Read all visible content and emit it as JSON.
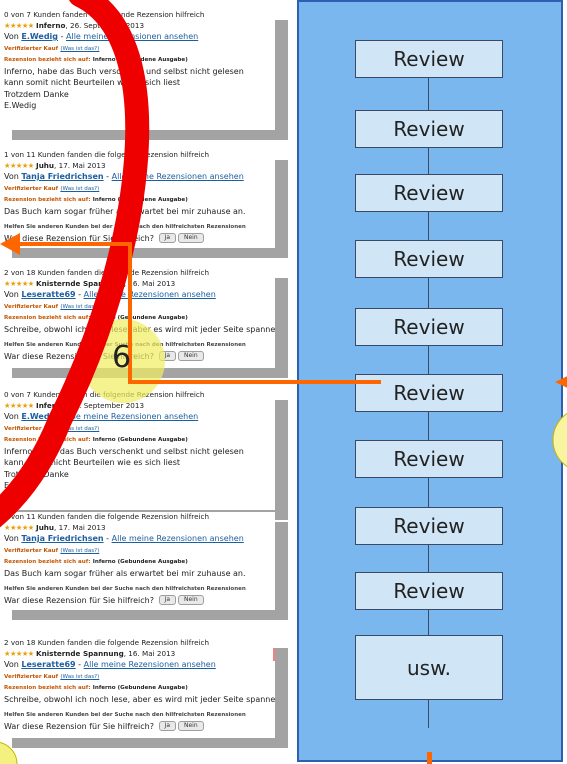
{
  "reviews": [
    {
      "helpful": "0 von 7 Kunden fanden die folgende Rezension hilfreich",
      "stars": "★★★★★",
      "title": "Inferno",
      "date": ", 26. September 2013",
      "by": "Von ",
      "author": "E.Wedig",
      "all_link": "Alle meine Rezensionen ansehen",
      "verified": "Verifizierter Kauf",
      "what": "(Was ist das?)",
      "refers_label": "Rezension bezieht sich auf:",
      "refers_value": "Inferno (Gebundene Ausgabe)",
      "body": [
        "Inferno, habe das Buch verschenkt und selbst nicht gelesen",
        "kann somit nicht Beurteilen wie es sich liest",
        "Trotzdem Danke",
        "E.Wedig"
      ],
      "help": "",
      "question": "",
      "yes": "",
      "no": ""
    },
    {
      "helpful": "1 von 11 Kunden fanden die folgende Rezension hilfreich",
      "stars": "★★★★★",
      "title": "Juhu",
      "date": ", 17. Mai 2013",
      "by": "Von ",
      "author": "Tanja Friedrichsen",
      "all_link": "Alle meine Rezensionen ansehen",
      "verified": "Verifizierter Kauf",
      "what": "(Was ist das?)",
      "refers_label": "Rezension bezieht sich auf:",
      "refers_value": "Inferno (Gebundene Ausgabe)",
      "body": [
        "Das Buch kam sogar früher als erwartet bei mir zuhause an."
      ],
      "help": "Helfen Sie anderen Kunden bei der Suche nach den hilfreichsten Rezensionen",
      "question": "War diese Rezension für Sie hilfreich?",
      "yes": "Ja",
      "no": "Nein"
    },
    {
      "helpful": "2 von 18 Kunden fanden die folgende Rezension hilfreich",
      "stars": "★★★★★",
      "title": "Knisternde Spannung",
      "date": ", 16. Mai 2013",
      "by": "Von ",
      "author": "Leseratte69",
      "all_link": "Alle meine Rezensionen ansehen",
      "verified": "Verifizierter Kauf",
      "what": "(Was ist das?)",
      "refers_label": "Rezension bezieht sich auf:",
      "refers_value": "Inferno (Gebundene Ausgabe)",
      "body": [
        "Schreibe, obwohl ich noch lese, aber es wird mit jeder Seite spannender"
      ],
      "help": "Helfen Sie anderen Kunden bei der Suche nach den hilfreichsten Rezensionen",
      "question": "War diese Rezension für Sie hilfreich?",
      "yes": "Ja",
      "no": "Nein"
    },
    {
      "helpful": "0 von 7 Kunden fanden die folgende Rezension hilfreich",
      "stars": "★★★★★",
      "title": "Inferno",
      "date": ", 26. September 2013",
      "by": "Von ",
      "author": "E.Wedig",
      "all_link": "Alle meine Rezensionen ansehen",
      "verified": "Verifizierter Kauf",
      "what": "(Was ist das?)",
      "refers_label": "Rezension bezieht sich auf:",
      "refers_value": "Inferno (Gebundene Ausgabe)",
      "body": [
        "Inferno, habe das Buch verschenkt und selbst nicht gelesen",
        "kann somit nicht Beurteilen wie es sich liest",
        "Trotzdem Danke",
        "E.Wedig"
      ],
      "help": "",
      "question": "",
      "yes": "",
      "no": ""
    },
    {
      "helpful": "1 von 11 Kunden fanden die folgende Rezension hilfreich",
      "stars": "★★★★★",
      "title": "Juhu",
      "date": ", 17. Mai 2013",
      "by": "Von ",
      "author": "Tanja Friedrichsen",
      "all_link": "Alle meine Rezensionen ansehen",
      "verified": "Verifizierter Kauf",
      "what": "(Was ist das?)",
      "refers_label": "Rezension bezieht sich auf:",
      "refers_value": "Inferno (Gebundene Ausgabe)",
      "body": [
        "Das Buch kam sogar früher als erwartet bei mir zuhause an."
      ],
      "help": "Helfen Sie anderen Kunden bei der Suche nach den hilfreichsten Rezensionen",
      "question": "War diese Rezension für Sie hilfreich?",
      "yes": "Ja",
      "no": "Nein"
    },
    {
      "helpful": "2 von 18 Kunden fanden die folgende Rezension hilfreich",
      "stars": "★★★★★",
      "title": "Knisternde Spannung",
      "date": ", 16. Mai 2013",
      "by": "Von ",
      "author": "Leseratte69",
      "all_link": "Alle meine Rezensionen ansehen",
      "verified": "Verifizierter Kauf",
      "what": "(Was ist das?)",
      "refers_label": "Rezension bezieht sich auf:",
      "refers_value": "Inferno (Gebundene Ausgabe)",
      "body": [
        "Schreibe, obwohl ich noch lese, aber es wird mit jeder Seite spannender"
      ],
      "help": "Helfen Sie anderen Kunden bei der Suche nach den hilfreichsten Rezensionen",
      "question": "War diese Rezension für Sie hilfreich?",
      "yes": "Ja",
      "no": "Nein"
    }
  ],
  "diagram": {
    "boxes": [
      "Review",
      "Review",
      "Review",
      "Review",
      "Review",
      "Review",
      "Review",
      "Review",
      "Review",
      "usw."
    ]
  },
  "annotation": {
    "number": "6"
  },
  "colors": {
    "panel_fill": "#7ab7ee",
    "panel_border": "#2f5fb0",
    "box_fill": "#d0e6f6",
    "overlay_red": "#ee0000",
    "arrow_orange": "#ff6600",
    "highlight_yellow": "#f0ee60"
  }
}
